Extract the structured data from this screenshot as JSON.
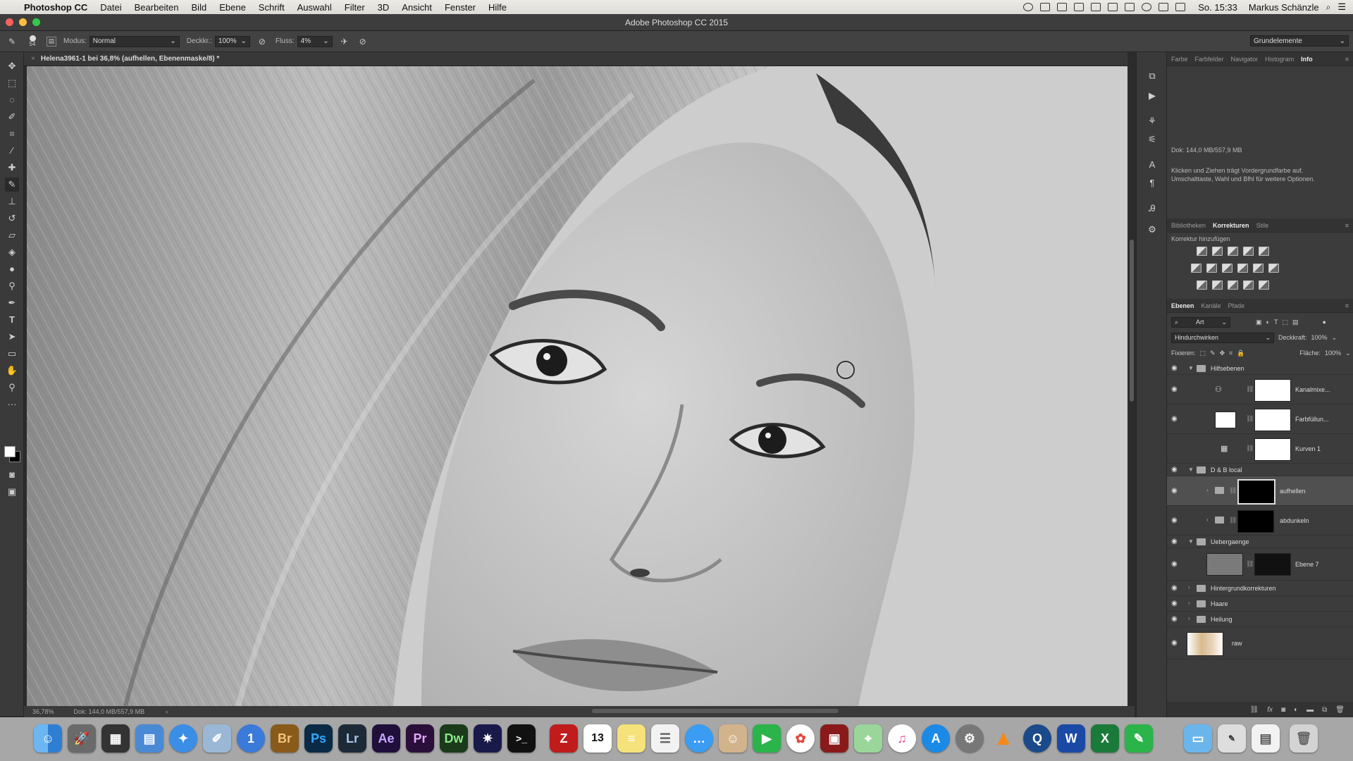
{
  "menubar": {
    "app": "Photoshop CC",
    "items": [
      "Datei",
      "Bearbeiten",
      "Bild",
      "Ebene",
      "Schrift",
      "Auswahl",
      "Filter",
      "3D",
      "Ansicht",
      "Fenster",
      "Hilfe"
    ],
    "clock": "So. 15:33",
    "user": "Markus Schänzle"
  },
  "window": {
    "title": "Adobe Photoshop CC 2015"
  },
  "options": {
    "brush_size": "54",
    "mode_label": "Modus:",
    "mode_value": "Normal",
    "opacity_label": "Deckkr.:",
    "opacity_value": "100%",
    "flow_label": "Fluss:",
    "flow_value": "4%",
    "workspace": "Grundelemente"
  },
  "document": {
    "tab": "Helena3961-1 bei 36,8% (aufhellen, Ebenenmaske/8) *"
  },
  "status": {
    "zoom": "36,78%",
    "doc": "Dok: 144,0 MB/557,9 MB"
  },
  "info_panel": {
    "tabs": [
      "Farbe",
      "Farbfelder",
      "Navigator",
      "Histogram",
      "Info"
    ],
    "active_tab": "Info",
    "doc": "Dok: 144,0 MB/557,9 MB",
    "hint": "Klicken und Ziehen trägt Vordergrundfarbe auf. Umschalttaste, Wahl und Bfhl für weitere Optionen."
  },
  "adjustments_panel": {
    "tabs": [
      "Bibliotheken",
      "Korrekturen",
      "Stile"
    ],
    "active_tab": "Korrekturen",
    "heading": "Korrektur hinzufügen"
  },
  "layers_panel": {
    "tabs": [
      "Ebenen",
      "Kanäle",
      "Pfade"
    ],
    "active_tab": "Ebenen",
    "filter": "Art",
    "blend": "Hindurchwirken",
    "opacity_label": "Deckkraft:",
    "opacity": "100%",
    "lock_label": "Fixieren:",
    "fill_label": "Fläche:",
    "fill": "100%",
    "layers": [
      {
        "name": "Hilfsebenen"
      },
      {
        "name": "Kanalmixe..."
      },
      {
        "name": "Farbfüllun..."
      },
      {
        "name": "Kurven 1"
      },
      {
        "name": "D & B local"
      },
      {
        "name": "aufhellen"
      },
      {
        "name": "abdunkeln"
      },
      {
        "name": "Uebergaenge"
      },
      {
        "name": "Ebene 7"
      },
      {
        "name": "Hintergrundkorrekturen"
      },
      {
        "name": "Haare"
      },
      {
        "name": "Heilung"
      },
      {
        "name": "raw"
      }
    ]
  },
  "dock": {
    "labels": [
      "Br",
      "Ps",
      "Lr",
      "Ae",
      "Pr",
      "Dw"
    ],
    "calendar_day": "13"
  },
  "colors": {
    "photoshop": "#31a8ff",
    "bridge": "#8a5a1a",
    "lightroom": "#4a6a8a",
    "aftereffects": "#5a3a8a",
    "premiere": "#5a2a7a",
    "dreamweaver": "#3a7a3a"
  }
}
